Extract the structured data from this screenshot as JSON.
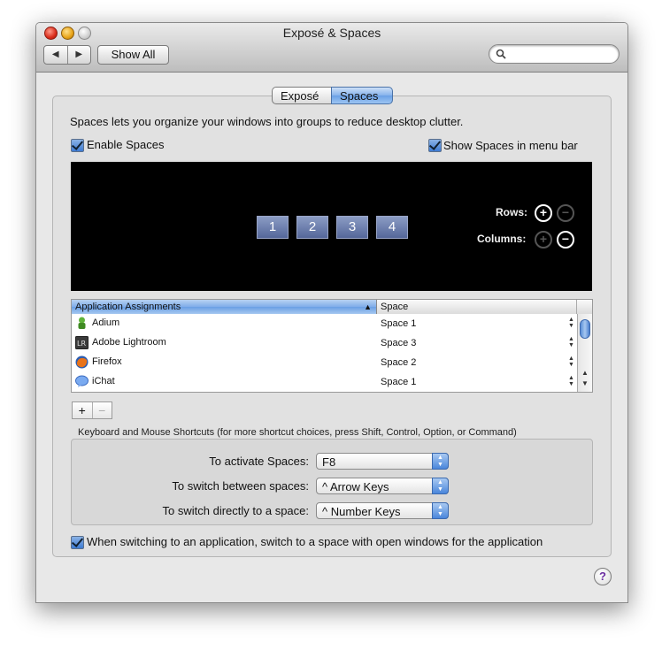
{
  "window": {
    "title": "Exposé & Spaces",
    "back_icon": "◀",
    "forward_icon": "▶",
    "show_all_label": "Show All",
    "search_placeholder": ""
  },
  "tabs": [
    {
      "label": "Exposé",
      "active": false
    },
    {
      "label": "Spaces",
      "active": true
    }
  ],
  "description": "Spaces lets you organize your windows into groups to reduce desktop clutter.",
  "enable_spaces": {
    "label": "Enable Spaces",
    "checked": true
  },
  "show_menu_bar": {
    "label": "Show Spaces in menu bar",
    "checked": true
  },
  "spaces_grid": {
    "tiles": [
      "1",
      "2",
      "3",
      "4"
    ],
    "rows_label": "Rows:",
    "columns_label": "Columns:",
    "plus": "+",
    "minus": "−"
  },
  "assignments": {
    "header_app": "Application Assignments",
    "header_space": "Space",
    "sort_icon": "▲",
    "rows": [
      {
        "app": "Adium",
        "space": "Space 1",
        "icon": "adium-icon",
        "color": "#4a9a2a"
      },
      {
        "app": "Adobe Lightroom",
        "space": "Space 3",
        "icon": "lightroom-icon",
        "color": "#3a3a3a"
      },
      {
        "app": "Firefox",
        "space": "Space 2",
        "icon": "firefox-icon",
        "color": "#e0701a"
      },
      {
        "app": "iChat",
        "space": "Space 1",
        "icon": "ichat-icon",
        "color": "#5a8ee0"
      }
    ],
    "stepper": "▲\n▼",
    "add": "+",
    "remove": "−"
  },
  "shortcuts": {
    "section_label": "Keyboard and Mouse Shortcuts (for more shortcut choices, press Shift, Control, Option, or Command)",
    "activate": {
      "label": "To activate Spaces:",
      "value": "F8"
    },
    "switch_between": {
      "label": "To switch between spaces:",
      "value": "^ Arrow Keys"
    },
    "switch_directly": {
      "label": "To switch directly to a space:",
      "value": "^ Number Keys"
    }
  },
  "switch_option": {
    "label": "When switching to an application, switch to a space with open windows for the application",
    "checked": true
  },
  "help_label": "?"
}
